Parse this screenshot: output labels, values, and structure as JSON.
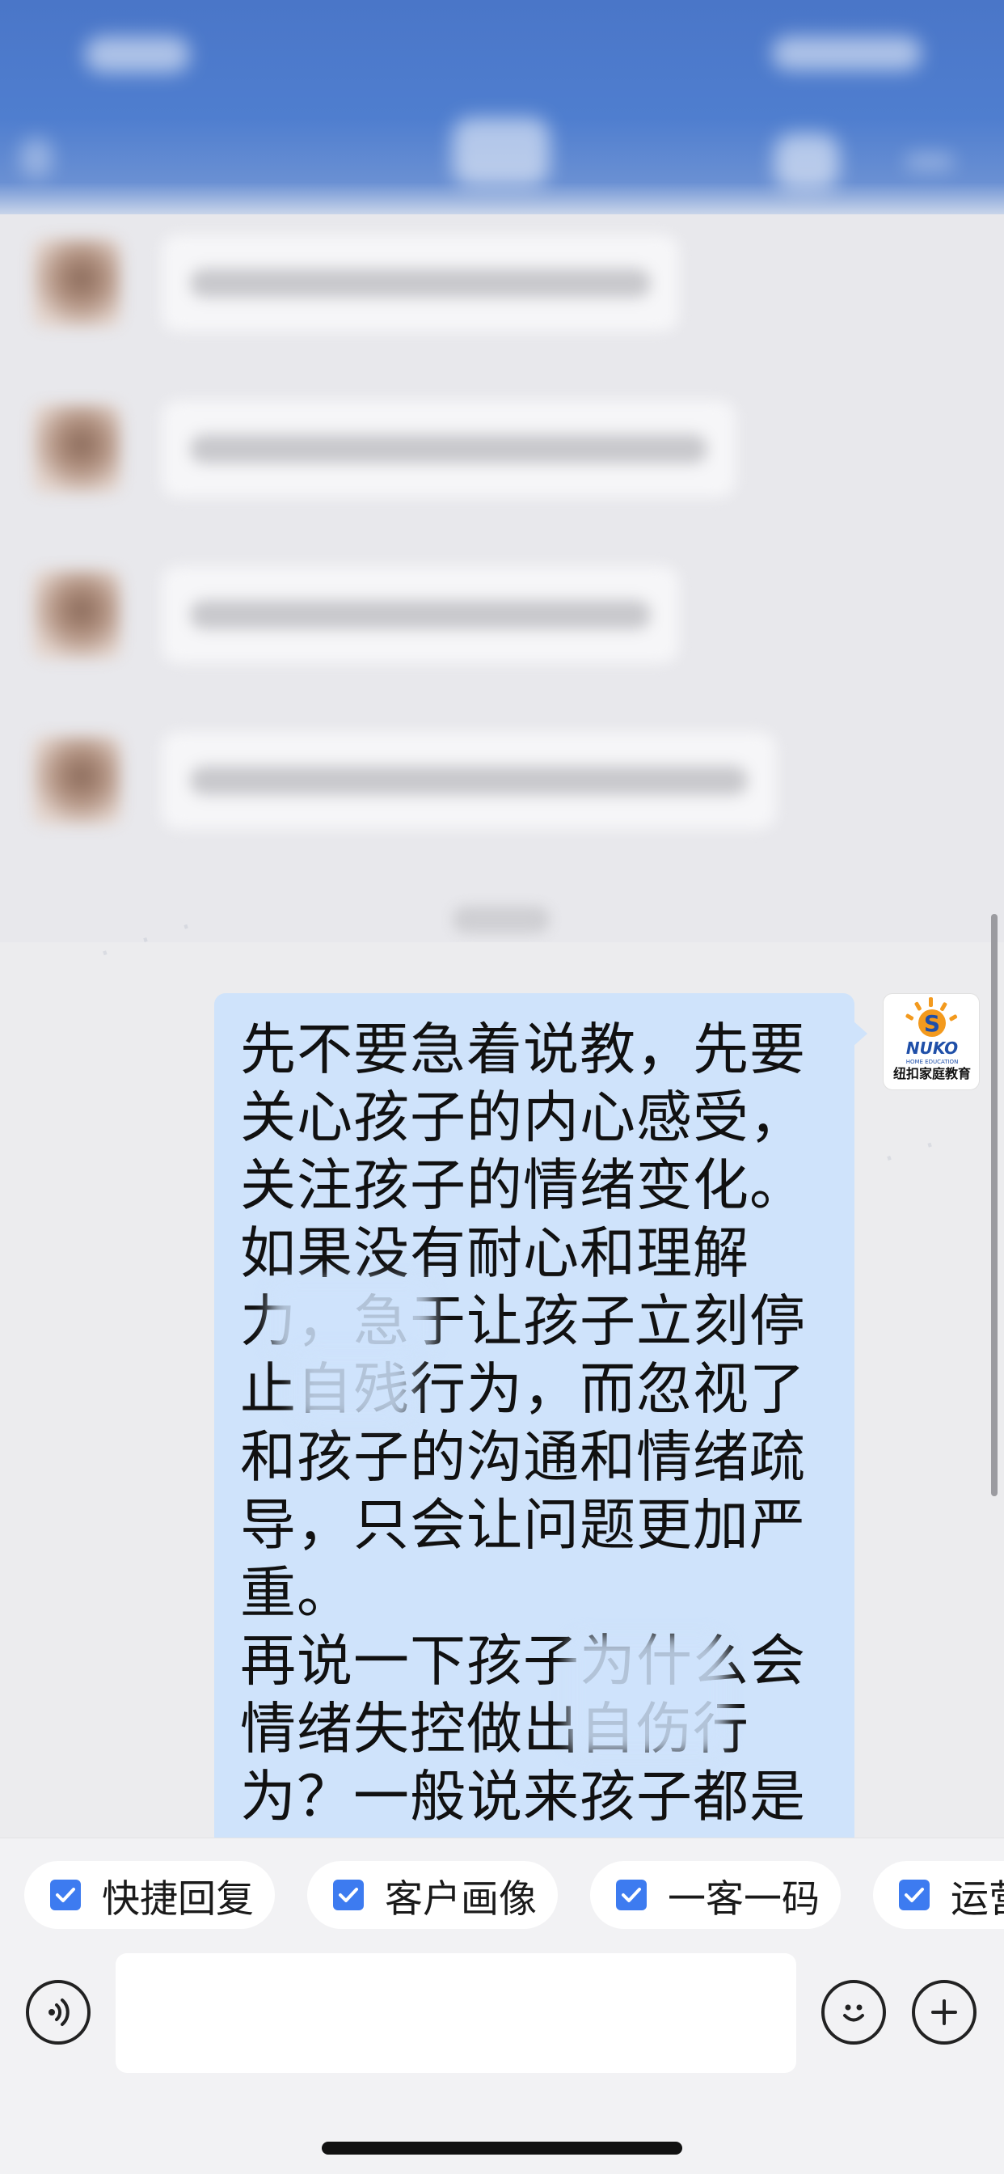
{
  "header": {
    "status_time": "",
    "title": ""
  },
  "previous_messages": [
    {
      "text_width_hint": "blurred"
    },
    {
      "text_width_hint": "blurred"
    },
    {
      "text_width_hint": "blurred"
    },
    {
      "text_width_hint": "blurred"
    }
  ],
  "message": {
    "text": "先不要急着说教，先要关心孩子的内心感受，\n关注孩子的情绪变化。\n如果没有耐心和理解力，急于让孩子立刻停止自残行为，而忽视了和孩子的沟通和情绪疏导，只会让问题更加严重。\n再说一下孩子为什么会情绪失控做出自伤行为？一般说来孩子都是"
  },
  "avatar": {
    "brand": "NUKO",
    "sub": "HOME EDUCATION",
    "name": "纽扣家庭教育"
  },
  "quick_actions": [
    {
      "label": "快捷回复"
    },
    {
      "label": "客户画像"
    },
    {
      "label": "一客一码"
    },
    {
      "label": "运营"
    }
  ],
  "input": {
    "placeholder": ""
  },
  "icons": {
    "voice": "voice-icon",
    "emoji": "emoji-icon",
    "plus": "plus-icon",
    "check": "check-icon"
  },
  "colors": {
    "header": "#4f7ecf",
    "bubble": "#cfe3fb",
    "check": "#3d7bf0",
    "logo_orange": "#f39a1e",
    "logo_blue": "#1f4fa8"
  }
}
